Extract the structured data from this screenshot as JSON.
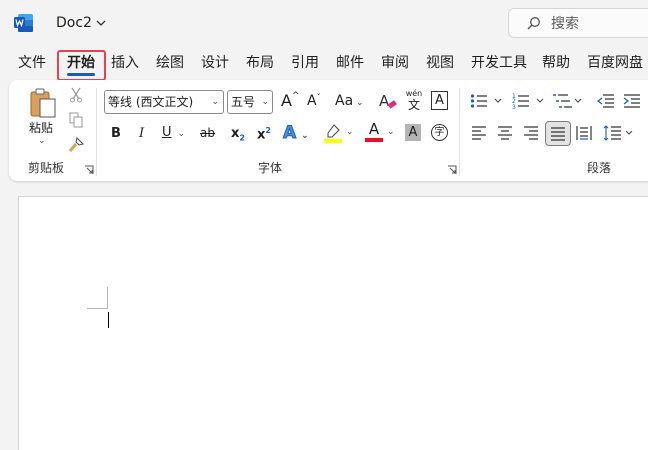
{
  "app": {
    "doc_title": "Doc2",
    "search_placeholder": "搜索"
  },
  "menu": {
    "tabs": [
      "文件",
      "开始",
      "插入",
      "绘图",
      "设计",
      "布局",
      "引用",
      "邮件",
      "审阅",
      "视图",
      "开发工具",
      "帮助",
      "百度网盘"
    ],
    "active_tab": "开始"
  },
  "ribbon": {
    "clipboard": {
      "label": "剪贴板",
      "paste_label": "粘贴"
    },
    "font": {
      "label": "字体",
      "font_name": "等线 (西文正文)",
      "font_size": "五号",
      "bold": "B",
      "italic": "I",
      "underline": "U",
      "strike": "ab",
      "subscript": "x",
      "superscript": "x",
      "sub_digit": "2",
      "sup_digit": "2",
      "text_effects": "A",
      "font_color": "A",
      "char_shading": "A",
      "grow": "A",
      "shrink": "A",
      "case": "Aa",
      "phonetic_top": "wén",
      "phonetic_bottom": "文",
      "border_char": "A",
      "enclose_char": "字"
    },
    "paragraph": {
      "label": "段落"
    }
  },
  "colors": {
    "highlight": "#ffff00",
    "font_color_bar": "#e81123",
    "accent": "#1b5fb5",
    "active_outline": "#e0454f",
    "word_blue": "#185abd"
  }
}
